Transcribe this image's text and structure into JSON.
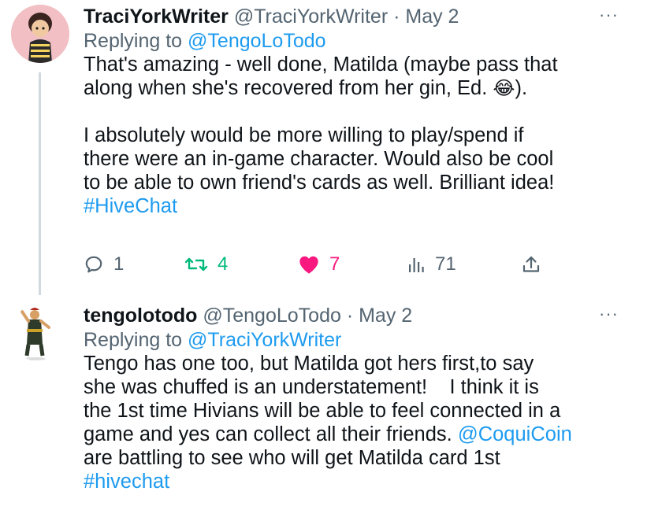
{
  "tweet1": {
    "display_name": "TraciYorkWriter",
    "handle": "@TraciYorkWriter",
    "separator": "·",
    "date": "May 2",
    "more_label": "···",
    "replying_prefix": "Replying to ",
    "replying_to": "@TengoLoTodo",
    "para1_line1": "That's amazing - well done, Matilda (maybe pass that",
    "para1_line2_start": "along when she's recovered from her gin, Ed. ",
    "emoji": "😂",
    "para1_line2_end": ").",
    "para2": "I absolutely would be more willing to play/spend if\nthere were an in-game character. Would also be cool\nto be able to own friend's cards as well. Brilliant idea!",
    "hashtag": "#HiveChat",
    "actions": {
      "replies": "1",
      "retweets": "4",
      "likes": "7",
      "views": "71"
    },
    "colors": {
      "retweet": "#00ba7c",
      "like": "#f91880",
      "link": "#1d9bf0",
      "muted": "#536471"
    }
  },
  "tweet2": {
    "display_name": "tengolotodo",
    "handle": "@TengoLoTodo",
    "separator": "·",
    "date": "May 2",
    "more_label": "···",
    "replying_prefix": "Replying to ",
    "replying_to": "@TraciYorkWriter",
    "body_part1": "Tengo has one too, but Matilda got hers first,to say\nshe was chuffed is an understatement!    I think it is\nthe 1st time Hivians will be able to feel connected in a\ngame and yes can collect all their friends. ",
    "mention": "@CoquiCoin",
    "body_part2": "\nare battling to see who will get Matilda card 1st\n",
    "hashtag": "#hivechat"
  }
}
